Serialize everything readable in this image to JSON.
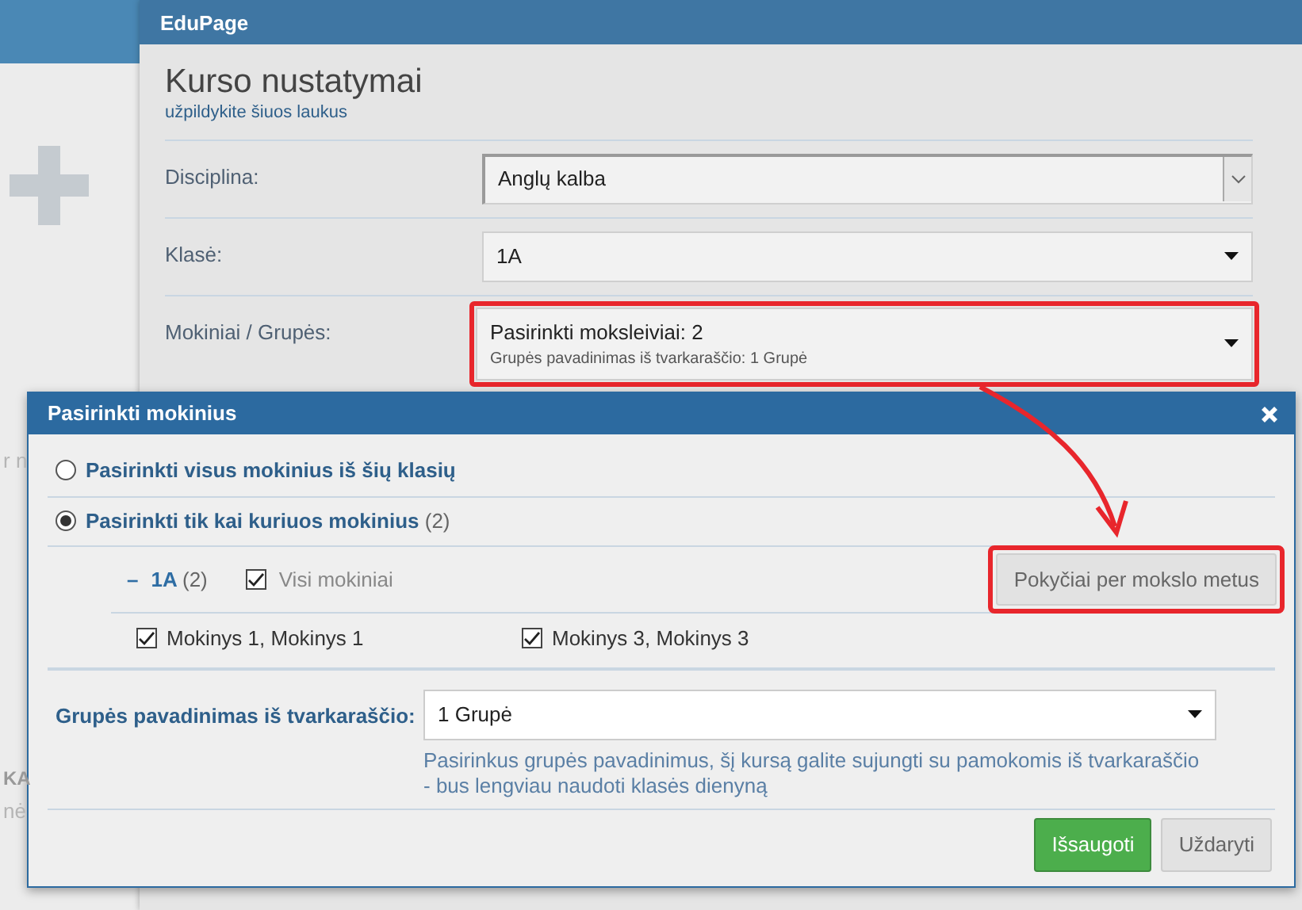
{
  "background_page": {
    "fragments": [
      "r n",
      "KA",
      "nė"
    ]
  },
  "course_dialog": {
    "title": "EduPage",
    "heading": "Kurso nustatymai",
    "subheading": "užpildykite šiuos laukus",
    "fields": [
      {
        "label": "Disciplina:",
        "kind": "native",
        "value": "Anglų kalba",
        "highlighted": false
      },
      {
        "label": "Klasė:",
        "kind": "select",
        "value": "1A",
        "highlighted": false
      },
      {
        "label": "Mokiniai / Grupės:",
        "kind": "multi",
        "value": "Pasirinkti moksleiviai: 2",
        "detail": "Grupės pavadinimas iš tvarkaraščio: 1 Grupė",
        "highlighted": true
      }
    ]
  },
  "students_dialog": {
    "title": "Pasirinkti mokinius",
    "options": [
      {
        "label": "Pasirinkti visus mokinius iš šių klasių",
        "selected": false
      },
      {
        "label": "Pasirinkti tik kai kuriuos mokinius",
        "count": "(2)",
        "selected": true
      }
    ],
    "class_group": {
      "toggle": "–",
      "name": "1A",
      "count": "(2)",
      "all": {
        "label": "Visi mokiniai",
        "checked": true
      },
      "changes_button": {
        "label": "Pokyčiai per mokslo metus",
        "highlighted": true
      },
      "students": [
        {
          "name": "Mokinys 1, Mokinys 1",
          "checked": true
        },
        {
          "name": "Mokinys 3, Mokinys 3",
          "checked": true
        }
      ]
    },
    "group_name": {
      "label": "Grupės pavadinimas iš tvarkaraščio:",
      "value": "1 Grupė",
      "help": "Pasirinkus grupės pavadinimus, šį kursą galite sujungti su pamokomis iš tvarkaraščio - bus lengviau naudoti klasės dienyną"
    },
    "buttons": [
      {
        "label": "Išsaugoti",
        "kind": "primary"
      },
      {
        "label": "Uždaryti",
        "kind": "secondary"
      }
    ]
  }
}
